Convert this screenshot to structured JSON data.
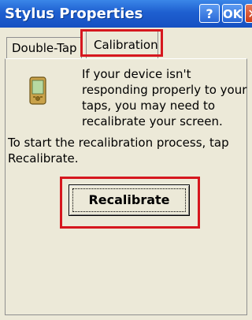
{
  "window": {
    "title": "Stylus Properties",
    "help_label": "?",
    "ok_label": "OK",
    "close_label": "✕"
  },
  "tabs": [
    {
      "label": "Double-Tap",
      "active": false
    },
    {
      "label": "Calibration",
      "active": true
    }
  ],
  "calibration": {
    "info_text": "If your device isn't responding properly to your taps, you may need to recalibrate your screen.",
    "start_text": "To start the recalibration process, tap Recalibrate.",
    "button_label": "Recalibrate"
  },
  "icons": {
    "device": "pda-device-icon"
  },
  "colors": {
    "titlebar": "#1e5fd0",
    "window_bg": "#ece9d8",
    "annotation": "#d6171e"
  }
}
